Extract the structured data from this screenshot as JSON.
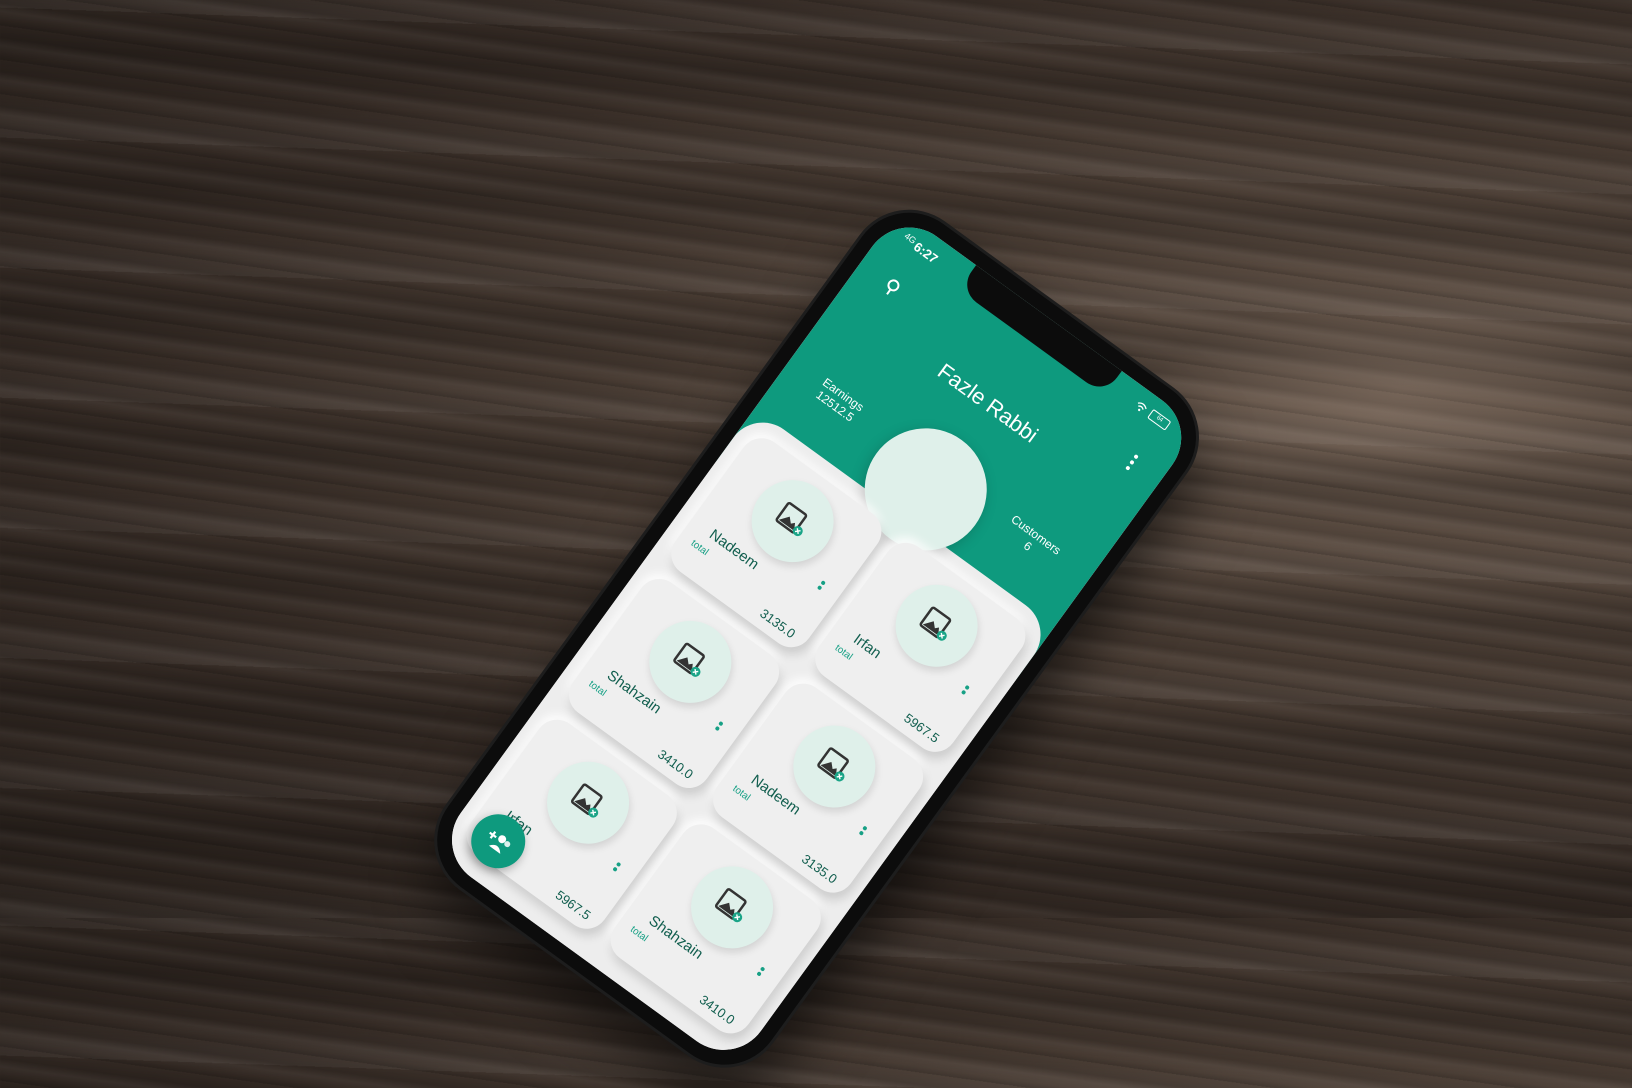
{
  "app": {
    "accent": "#0e9a7e",
    "title": "Fazle Rabbi",
    "icons": [
      "search-icon",
      "more-vert-icon",
      "person-add-icon",
      "image-icon"
    ]
  },
  "status_bar": {
    "time": "6:27",
    "signal": "4G",
    "battery": "64"
  },
  "stats": {
    "earnings_label": "Earnings",
    "earnings_value": "12512.5",
    "customers_label": "Customers",
    "customers_value": "6"
  },
  "customers": [
    {
      "name": "Nadeem",
      "label": "total",
      "amount": "3135.0"
    },
    {
      "name": "Irfan",
      "label": "total",
      "amount": "5967.5"
    },
    {
      "name": "Shahzain",
      "label": "total",
      "amount": "3410.0"
    },
    {
      "name": "Nadeem",
      "label": "total",
      "amount": "3135.0"
    },
    {
      "name": "Irfan",
      "label": "total",
      "amount": "5967.5"
    },
    {
      "name": "Shahzain",
      "label": "total",
      "amount": "3410.0"
    }
  ]
}
